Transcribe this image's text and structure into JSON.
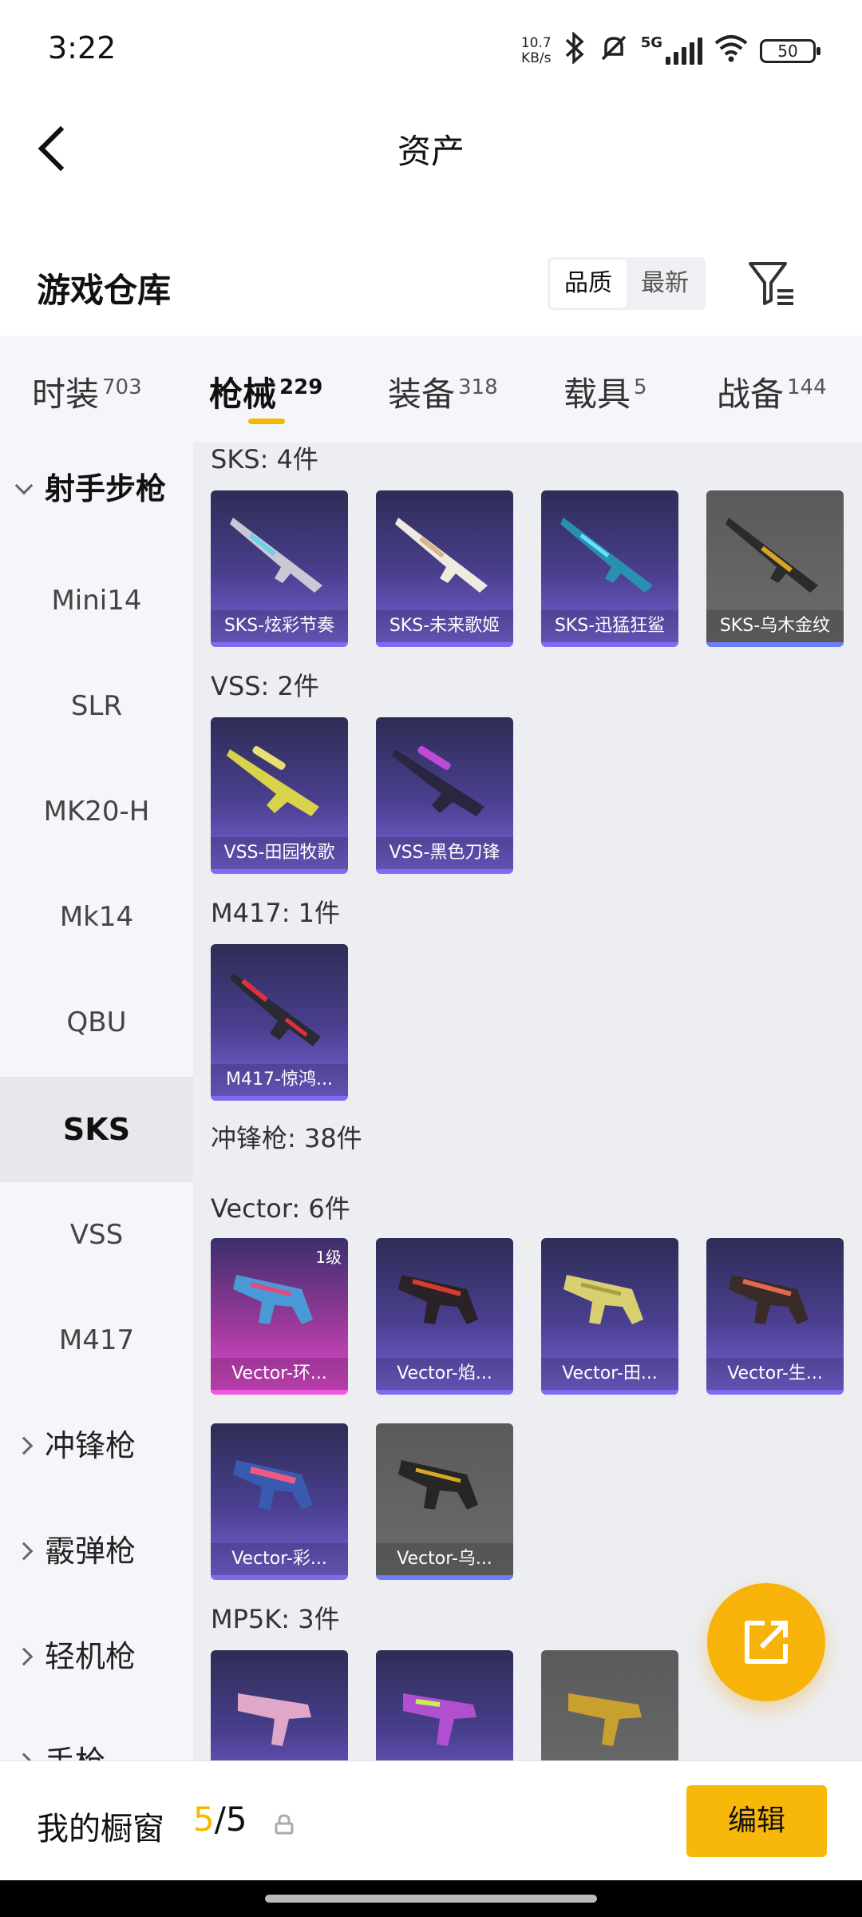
{
  "status": {
    "time": "3:22",
    "net_speed_value": "10.7",
    "net_speed_unit": "KB/s",
    "network": "5G",
    "battery": "50"
  },
  "header": {
    "title": "资产"
  },
  "warehouse": {
    "title": "游戏仓库",
    "sort_options": [
      "品质",
      "最新"
    ]
  },
  "tabs": [
    {
      "label": "时装",
      "count": "703"
    },
    {
      "label": "枪械",
      "count": "229"
    },
    {
      "label": "装备",
      "count": "318"
    },
    {
      "label": "载具",
      "count": "5"
    },
    {
      "label": "战备",
      "count": "144"
    }
  ],
  "sidebar": {
    "group_open": "射手步枪",
    "items": [
      "Mini14",
      "SLR",
      "MK20-H",
      "Mk14",
      "QBU",
      "SKS",
      "VSS",
      "M417"
    ],
    "groups_closed": [
      "冲锋枪",
      "霰弹枪",
      "轻机枪",
      "手枪"
    ]
  },
  "sections": {
    "sks_title": "SKS: 4件",
    "sks": [
      "SKS-炫彩节奏",
      "SKS-未来歌姬",
      "SKS-迅猛狂鲨",
      "SKS-乌木金纹"
    ],
    "vss_title": "VSS: 2件",
    "vss": [
      "VSS-田园牧歌",
      "VSS-黑色刀锋"
    ],
    "m417_title": "M417: 1件",
    "m417": [
      "M417-惊鸿..."
    ],
    "smg_title": "冲锋枪: 38件",
    "vector_title": "Vector: 6件",
    "vector": [
      "Vector-环...",
      "Vector-焰...",
      "Vector-田...",
      "Vector-生...",
      "Vector-彩...",
      "Vector-乌..."
    ],
    "vector_level": "1级",
    "mp5k_title": "MP5K: 3件"
  },
  "bottom": {
    "my_window": "我的橱窗",
    "count_current": "5",
    "count_total": "/5",
    "edit": "编辑"
  }
}
